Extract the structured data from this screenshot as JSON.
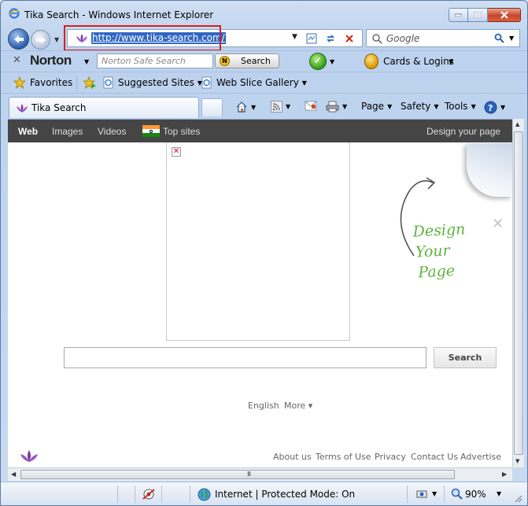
{
  "window": {
    "title": "Tika Search - Windows Internet Explorer"
  },
  "address_bar": {
    "url": "http://www.tika-search.com/",
    "search_placeholder": "Google"
  },
  "norton_toolbar": {
    "brand": "Norton",
    "search_placeholder": "Norton Safe Search",
    "search_button": "Search",
    "cards_label": "Cards & Logins"
  },
  "favorites_bar": {
    "favorites": "Favorites",
    "suggested_sites": "Suggested Sites",
    "web_slice_gallery": "Web Slice Gallery"
  },
  "tab_bar": {
    "active_tab": "Tika Search",
    "commands": {
      "page": "Page",
      "safety": "Safety",
      "tools": "Tools"
    }
  },
  "site": {
    "nav": {
      "web": "Web",
      "images": "Images",
      "videos": "Videos",
      "top_sites": "Top sites",
      "design": "Design your page"
    },
    "promo": {
      "line1": "Design",
      "line2": "Your",
      "line3": "Page"
    },
    "search_button": "Search",
    "language": "English",
    "more": "More ▾",
    "footer_links": [
      "About us",
      "Terms of Use",
      "Privacy",
      "Contact Us",
      "Advertise"
    ]
  },
  "status_bar": {
    "zone": "Internet | Protected Mode: On",
    "zoom": "90%"
  },
  "colors": {
    "site_nav_bg": "#454545",
    "promo_green": "#5fb341",
    "url_highlight": "#d62020"
  }
}
